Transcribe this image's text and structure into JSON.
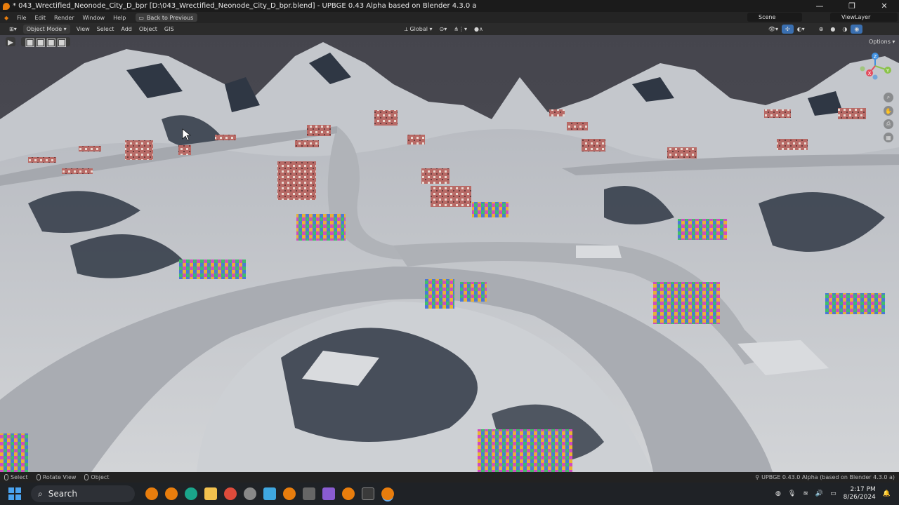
{
  "window": {
    "title": "* 043_Wrectified_Neonode_City_D_bpr [D:\\043_Wrectified_Neonode_City_D_bpr.blend] - UPBGE 0.43 Alpha based on Blender 4.3.0 a",
    "controls": [
      "—",
      "❐",
      "✕"
    ]
  },
  "menu": {
    "items": [
      "File",
      "Edit",
      "Render",
      "Window",
      "Help"
    ],
    "back_button": "Back to Previous",
    "scene": "Scene",
    "view_layer": "ViewLayer"
  },
  "header": {
    "mode": "Object Mode",
    "menus": [
      "View",
      "Select",
      "Add",
      "Object",
      "GIS"
    ],
    "transform_orientation": "Global",
    "options": "Options"
  },
  "gizmo": {
    "axes": [
      "Z",
      "Y",
      "X"
    ],
    "colors": {
      "x": "#e44d5e",
      "y": "#8bc34a",
      "z": "#3f8fe0"
    }
  },
  "status": {
    "select": "Select",
    "rotate": "Rotate View",
    "object": "Object",
    "version": "UPBGE 0.43.0 Alpha (based on Blender 4.3.0 a)"
  },
  "taskbar": {
    "search": "Search",
    "time": "2:17 PM",
    "date": "8/26/2024"
  },
  "colors": {
    "accent": "#e87d0d",
    "sky": "#4a4a52",
    "snow": "#c9ccd0",
    "shadow": "#2f3744"
  }
}
